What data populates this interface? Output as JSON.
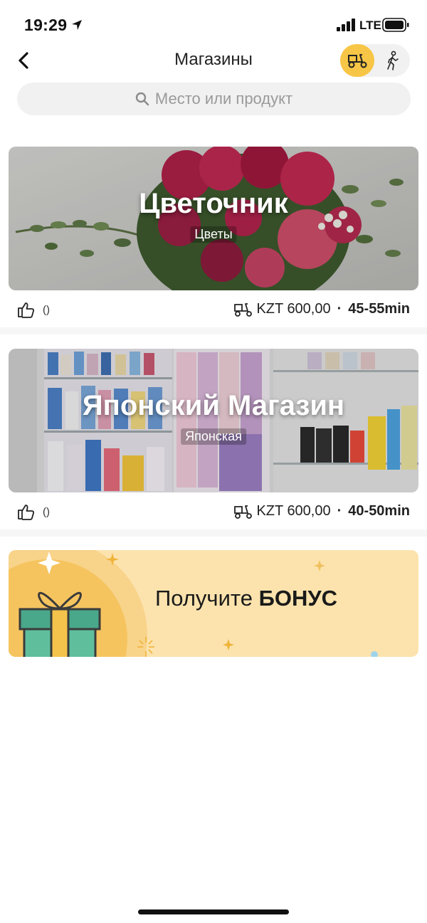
{
  "status_bar": {
    "time": "19:29",
    "network": "LTE"
  },
  "header": {
    "title": "Магазины"
  },
  "search": {
    "placeholder": "Место или продукт"
  },
  "stores": [
    {
      "name": "Цветочник",
      "category": "Цветы",
      "likes": "()",
      "fee": "KZT 600,00",
      "eta": "45-55min"
    },
    {
      "name": "Японский Магазин",
      "category": "Японская",
      "likes": "()",
      "fee": "KZT 600,00",
      "eta": "40-50min"
    }
  ],
  "bonus": {
    "prefix": "Получите ",
    "emphasis": "БОНУС"
  },
  "icons": {
    "back": "chevron-left-icon",
    "delivery_mode": "scooter-icon",
    "pickup_mode": "walking-person-icon",
    "search": "search-icon",
    "like": "thumbs-up-icon",
    "fee": "scooter-icon"
  },
  "colors": {
    "accent": "#f7c646",
    "bonus_bg": "#fce3ad",
    "gift_box": "#4aa88a"
  }
}
